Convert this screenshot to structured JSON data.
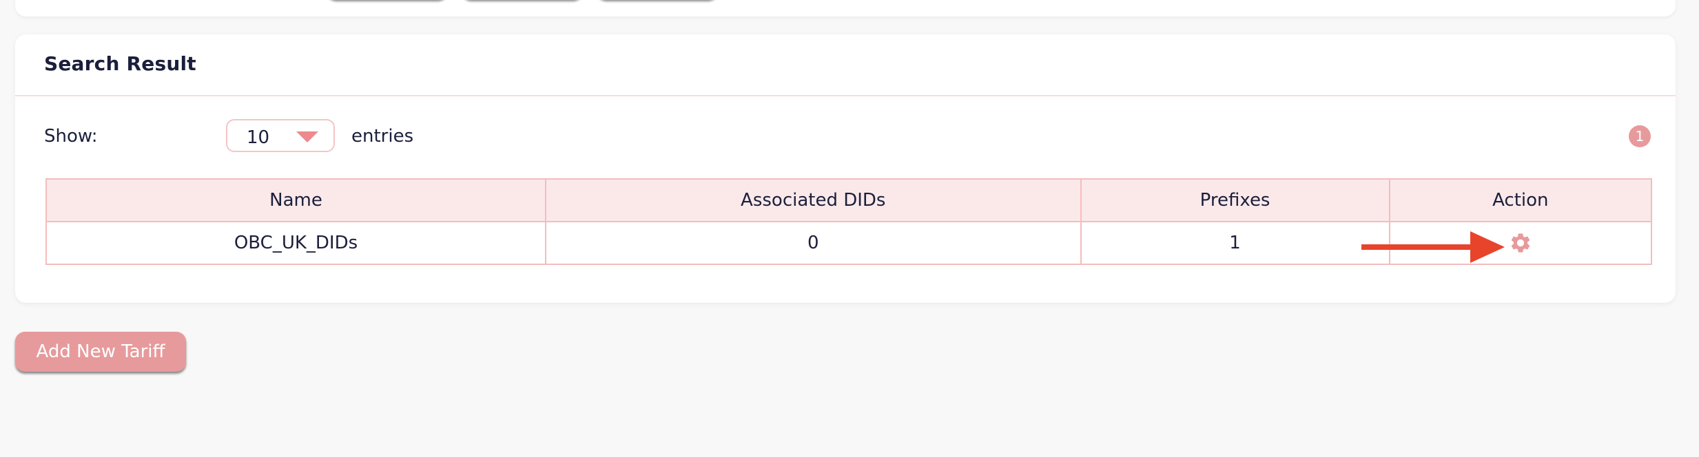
{
  "results": {
    "title": "Search Result",
    "show_label": "Show:",
    "page_size": "10",
    "entries_label": "entries",
    "page_count": "1",
    "columns": [
      "Name",
      "Associated DIDs",
      "Prefixes",
      "Action"
    ],
    "rows": [
      {
        "name": "OBC_UK_DIDs",
        "associated_dids": "0",
        "prefixes": "1",
        "action_icon": "gear-icon"
      }
    ]
  },
  "add_button_label": "Add New Tariff",
  "colors": {
    "accent": "#e79a9c",
    "header_bg": "#fbe9ea",
    "border": "#f4bcbc",
    "annotation_arrow": "#e8442c",
    "text": "#1b1f3b",
    "background": "#f8f8f8"
  }
}
